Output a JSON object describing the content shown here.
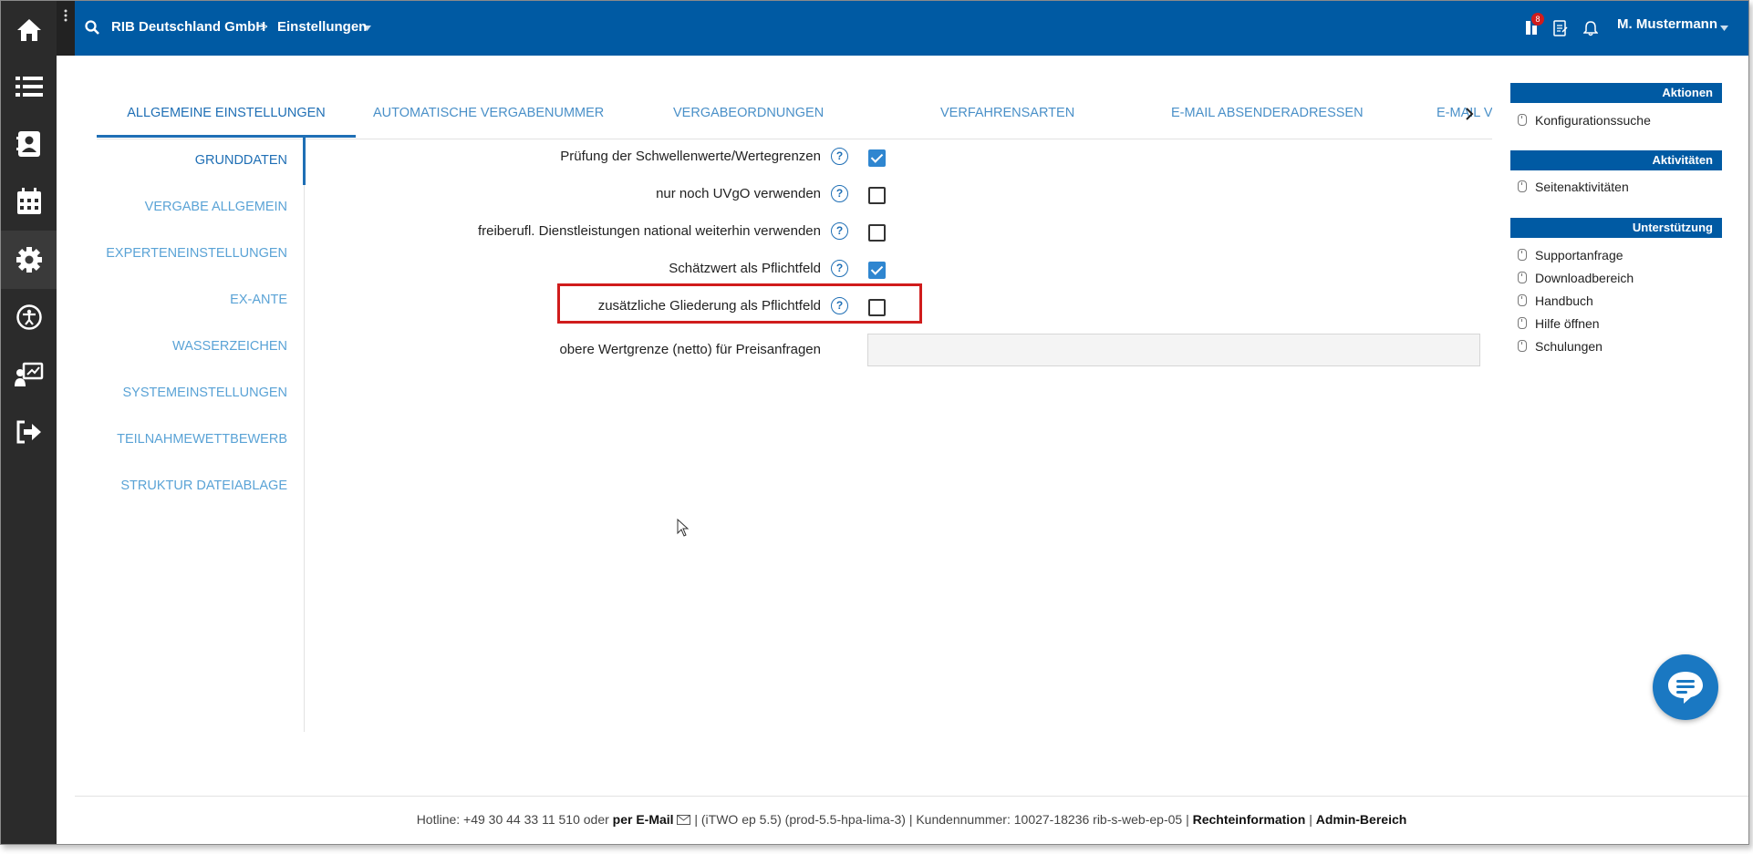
{
  "colors": {
    "topbar": "#005aa3",
    "accent": "#1f6fb5",
    "highlight": "#d01c1c",
    "sidebar": "#2b2b2b"
  },
  "topbar": {
    "search_icon": "search-icon",
    "company": "RIB Deutschland GmbH",
    "separator": ">",
    "section": "Einstellungen",
    "user": "M. Mustermann",
    "notification_badge": "8"
  },
  "sidebar_icons": [
    "home-icon",
    "list-icon",
    "contacts-icon",
    "calendar-icon",
    "gear-icon",
    "accessibility-icon",
    "presentation-icon",
    "logout-icon"
  ],
  "tabs": [
    {
      "label": "ALLGEMEINE EINSTELLUNGEN",
      "active": true
    },
    {
      "label": "AUTOMATISCHE VERGABENUMMER"
    },
    {
      "label": "VERGABEORDNUNGEN"
    },
    {
      "label": "VERFAHRENSARTEN"
    },
    {
      "label": "E-MAIL ABSENDERADRESSEN"
    },
    {
      "label": "E-MAIL V"
    }
  ],
  "subnav": [
    {
      "label": "GRUNDDATEN",
      "active": true
    },
    {
      "label": "VERGABE ALLGEMEIN"
    },
    {
      "label": "EXPERTENEINSTELLUNGEN"
    },
    {
      "label": "EX-ANTE"
    },
    {
      "label": "WASSERZEICHEN"
    },
    {
      "label": "SYSTEMEINSTELLUNGEN"
    },
    {
      "label": "TEILNAHMEWETTBEWERB"
    },
    {
      "label": "STRUKTUR DATEIABLAGE"
    }
  ],
  "form": {
    "rows": [
      {
        "label": "Prüfung der Schwellenwerte/Wertegrenzen",
        "checked": true
      },
      {
        "label": "nur noch UVgO verwenden",
        "checked": false
      },
      {
        "label": "freiberufl. Dienstleistungen national weiterhin verwenden",
        "checked": false
      },
      {
        "label": "Schätzwert als Pflichtfeld",
        "checked": true
      },
      {
        "label": "zusätzliche Gliederung als Pflichtfeld",
        "checked": false
      }
    ],
    "price_label": "obere Wertgrenze (netto) für Preisanfragen",
    "price_value": "",
    "help_glyph": "?"
  },
  "right_panel": {
    "aktionen": {
      "title": "Aktionen",
      "items": [
        "Konfigurationssuche"
      ]
    },
    "aktivitaeten": {
      "title": "Aktivitäten",
      "items": [
        "Seitenaktivitäten"
      ]
    },
    "unterstuetzung": {
      "title": "Unterstützung",
      "items": [
        "Supportanfrage",
        "Downloadbereich",
        "Handbuch",
        "Hilfe öffnen",
        "Schulungen"
      ]
    }
  },
  "footer": {
    "hotline": "Hotline: +49 30 44 33 11 510 oder",
    "email_link": "per E-Mail",
    "version": "| (iTWO ep 5.5) (prod-5.5-hpa-lima-3) | Kundennummer: 10027-18236 rib-s-web-ep-05 |",
    "legal_link": "Rechteinformation",
    "sep": "|",
    "admin_link": "Admin-Bereich"
  }
}
